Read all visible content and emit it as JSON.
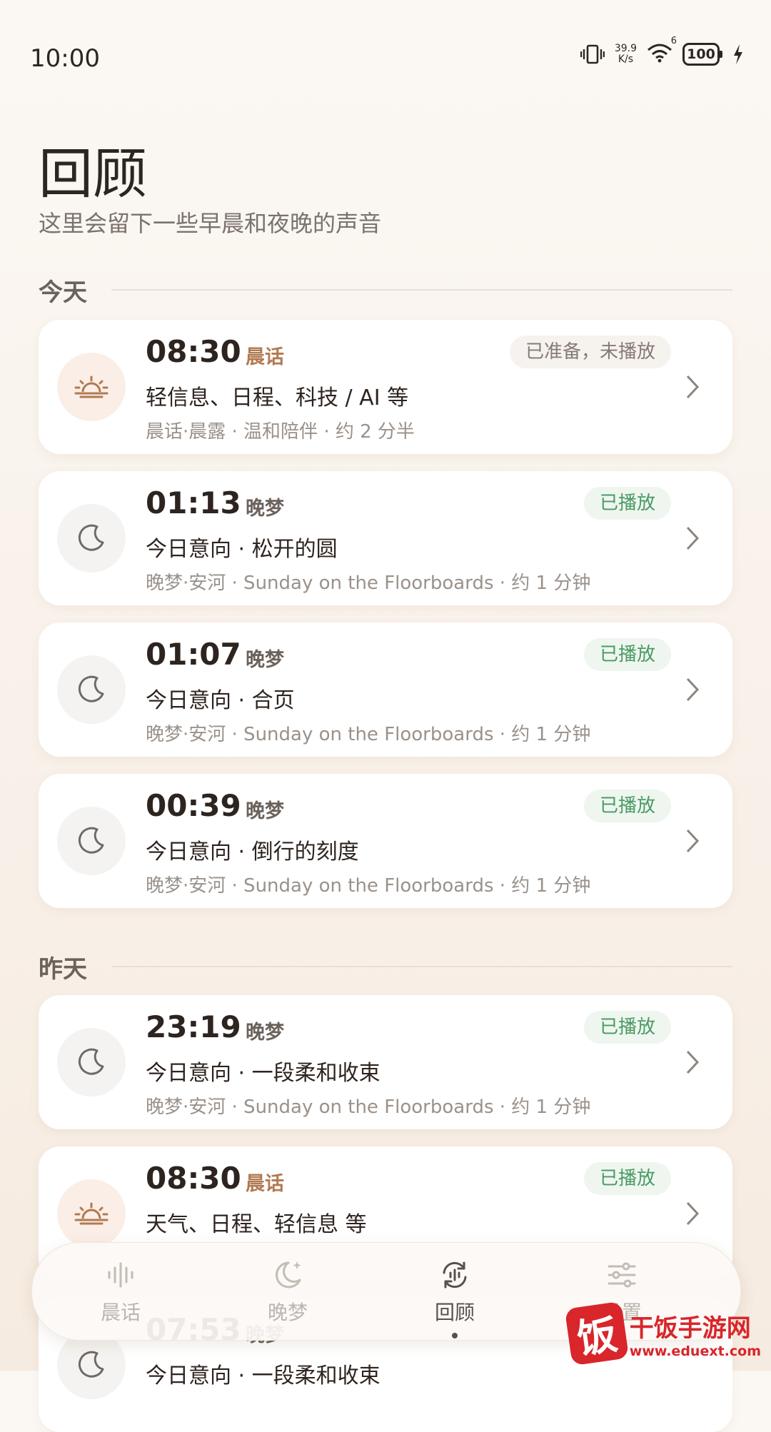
{
  "status_bar": {
    "time": "10:00",
    "net_speed_value": "39.9",
    "net_speed_unit": "K/s",
    "signal_label": "6",
    "battery": "100"
  },
  "page": {
    "title": "回顾",
    "subtitle": "这里会留下一些早晨和夜晚的声音"
  },
  "sections": [
    {
      "label": "今天",
      "items": [
        {
          "time": "08:30",
          "kind": "晨话",
          "kind_type": "morning",
          "status": "已准备，未播放",
          "status_type": "ready",
          "title": "轻信息、日程、科技 / AI 等",
          "meta": "晨话·晨露 · 温和陪伴 · 约 2 分半",
          "icon": "sunrise-icon"
        },
        {
          "time": "01:13",
          "kind": "晚梦",
          "kind_type": "night",
          "status": "已播放",
          "status_type": "played",
          "title": "今日意向 · 松开的圆",
          "meta": "晚梦·安河 · Sunday on the Floorboards · 约 1 分钟",
          "icon": "moon-icon"
        },
        {
          "time": "01:07",
          "kind": "晚梦",
          "kind_type": "night",
          "status": "已播放",
          "status_type": "played",
          "title": "今日意向 · 合页",
          "meta": "晚梦·安河 · Sunday on the Floorboards · 约 1 分钟",
          "icon": "moon-icon"
        },
        {
          "time": "00:39",
          "kind": "晚梦",
          "kind_type": "night",
          "status": "已播放",
          "status_type": "played",
          "title": "今日意向 · 倒行的刻度",
          "meta": "晚梦·安河 · Sunday on the Floorboards · 约 1 分钟",
          "icon": "moon-icon"
        }
      ]
    },
    {
      "label": "昨天",
      "items": [
        {
          "time": "23:19",
          "kind": "晚梦",
          "kind_type": "night",
          "status": "已播放",
          "status_type": "played",
          "title": "今日意向 · 一段柔和收束",
          "meta": "晚梦·安河 · Sunday on the Floorboards · 约 1 分钟",
          "icon": "moon-icon"
        },
        {
          "time": "08:30",
          "kind": "晨话",
          "kind_type": "morning",
          "status": "已播放",
          "status_type": "played",
          "title": "天气、日程、轻信息 等",
          "meta": "",
          "icon": "sunrise-icon"
        },
        {
          "time": "07:53",
          "kind": "晚梦",
          "kind_type": "night",
          "status": "",
          "status_type": "played",
          "title": "今日意向 · 一段柔和收束",
          "meta": "",
          "icon": "moon-icon"
        }
      ]
    }
  ],
  "bottom_nav": [
    {
      "label": "晨话",
      "icon": "waveform-icon",
      "active": false
    },
    {
      "label": "晚梦",
      "icon": "moon-star-icon",
      "active": false
    },
    {
      "label": "回顾",
      "icon": "review-icon",
      "active": true
    },
    {
      "label": "设置",
      "icon": "sliders-icon",
      "active": false
    }
  ],
  "watermark": {
    "badge": "饭",
    "title": "干饭手游网",
    "url": "www.eduext.com"
  },
  "colors": {
    "accent_morning": "#b07a52",
    "played_green": "#4a9a64",
    "background": "#fbf8f4"
  }
}
